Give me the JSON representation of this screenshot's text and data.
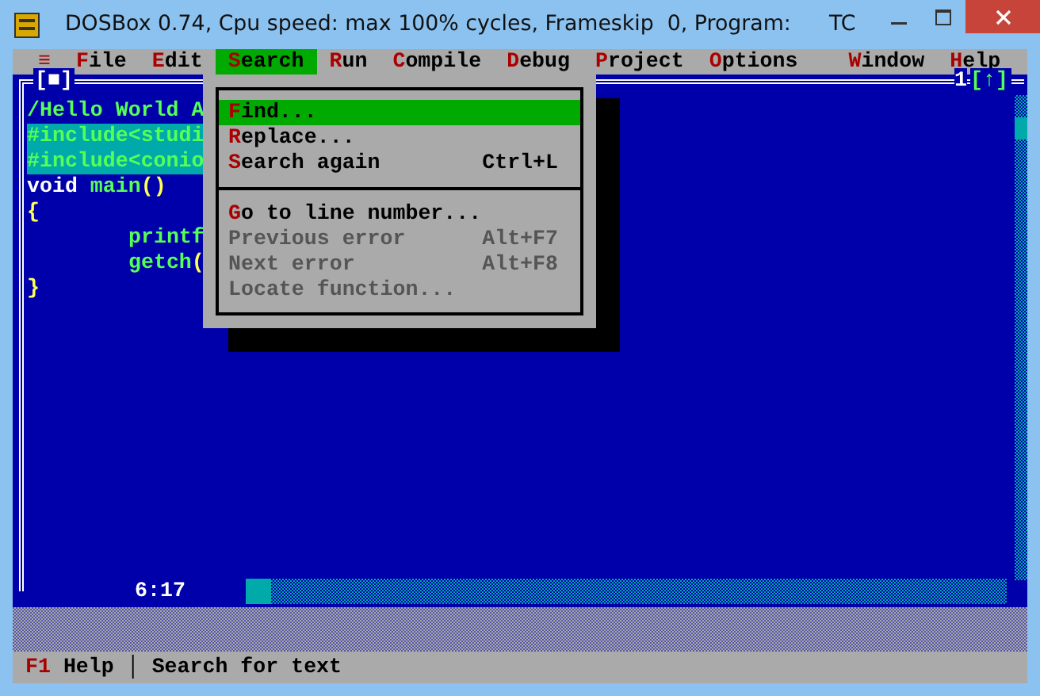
{
  "window": {
    "title": "DOSBox 0.74, Cpu speed: max 100% cycles, Frameskip  0, Program:",
    "program": "TC"
  },
  "menu_bar": {
    "system_menu": "≡",
    "items": [
      {
        "label": "File",
        "selected": false
      },
      {
        "label": "Edit",
        "selected": false
      },
      {
        "label": "Search",
        "selected": true
      },
      {
        "label": "Run",
        "selected": false
      },
      {
        "label": "Compile",
        "selected": false
      },
      {
        "label": "Debug",
        "selected": false
      },
      {
        "label": "Project",
        "selected": false
      },
      {
        "label": "Options",
        "selected": false
      },
      {
        "label": "Window",
        "selected": false
      },
      {
        "label": "Help",
        "selected": false
      }
    ]
  },
  "editor": {
    "close_box": "[■]",
    "window_number": "1",
    "zoom_box": "[↑]",
    "cursor_position": "6:17",
    "lines": [
      {
        "selected": false,
        "indented": false,
        "tokens": [
          {
            "kind": "comment",
            "text": "/Hello World A"
          }
        ]
      },
      {
        "selected": true,
        "indented": false,
        "tokens": [
          {
            "kind": "directive",
            "text": "#include<studi"
          }
        ]
      },
      {
        "selected": true,
        "indented": false,
        "tokens": [
          {
            "kind": "directive",
            "text": "#include<conio"
          }
        ]
      },
      {
        "selected": false,
        "indented": false,
        "tokens": [
          {
            "kind": "keyword",
            "text": "void"
          },
          {
            "kind": "ident",
            "text": "main"
          },
          {
            "kind": "punct",
            "text": "()"
          }
        ]
      },
      {
        "selected": false,
        "indented": false,
        "tokens": [
          {
            "kind": "punct",
            "text": "{"
          }
        ]
      },
      {
        "selected": false,
        "indented": true,
        "tokens": [
          {
            "kind": "ident",
            "text": "printf"
          }
        ]
      },
      {
        "selected": false,
        "indented": true,
        "tokens": [
          {
            "kind": "ident",
            "text": "getch"
          },
          {
            "kind": "punct",
            "text": "("
          }
        ]
      },
      {
        "selected": false,
        "indented": false,
        "tokens": [
          {
            "kind": "punct",
            "text": "}"
          }
        ]
      }
    ]
  },
  "search_menu": {
    "groups": [
      [
        {
          "label": "Find...",
          "selected": true,
          "disabled": false
        },
        {
          "label": "Replace...",
          "selected": false,
          "disabled": false
        },
        {
          "label": "Search again",
          "shortcut": "Ctrl+L",
          "selected": false,
          "disabled": false
        }
      ],
      [
        {
          "label": "Go to line number...",
          "selected": false,
          "disabled": false
        },
        {
          "label": "Previous error",
          "shortcut": "Alt+F7",
          "selected": false,
          "disabled": true
        },
        {
          "label": "Next error",
          "shortcut": "Alt+F8",
          "selected": false,
          "disabled": true
        },
        {
          "label": "Locate function...",
          "selected": false,
          "disabled": true
        }
      ]
    ]
  },
  "status_bar": {
    "key": "F1",
    "key_label": "Help",
    "separator": "│",
    "hint": "Search for text"
  }
}
